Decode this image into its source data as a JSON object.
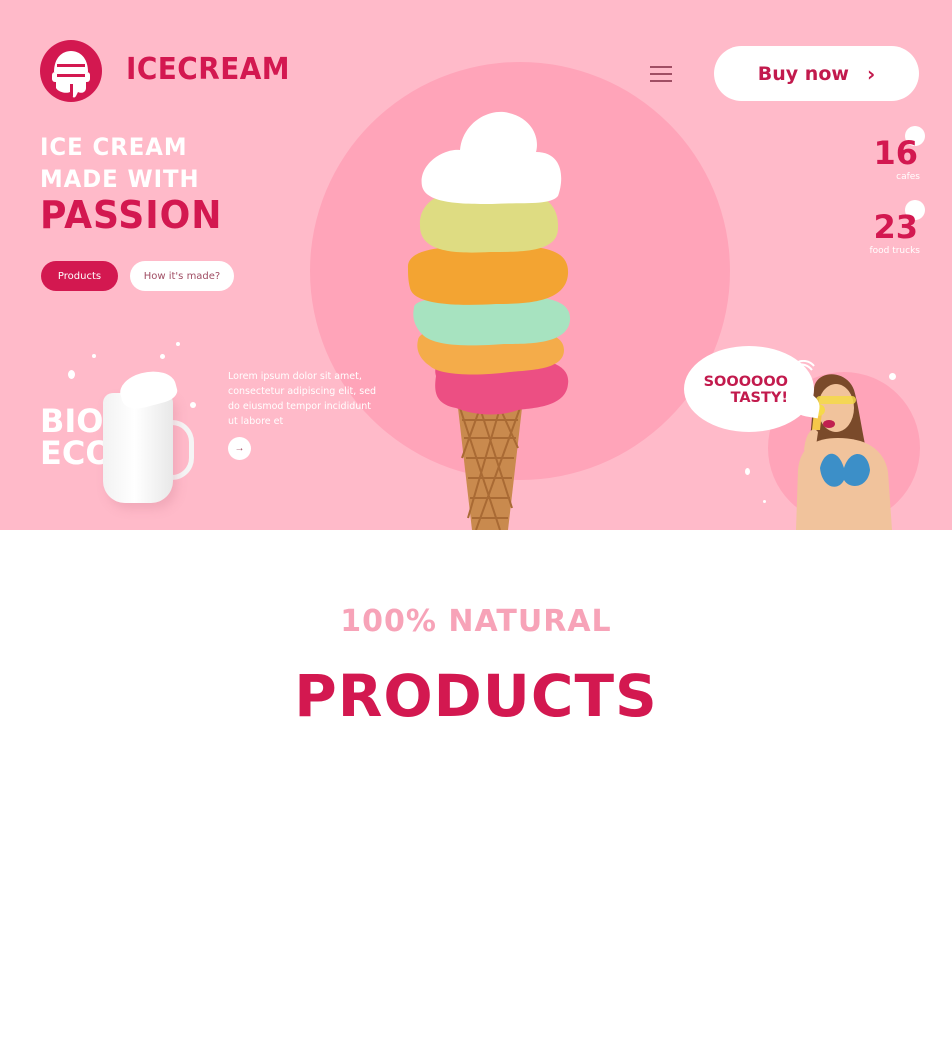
{
  "brand": {
    "name": "ICECREAM",
    "logo_icon": "ice-cream-helmet-logo"
  },
  "header": {
    "menu_icon": "hamburger-menu-icon",
    "buy_label": "Buy now",
    "buy_icon": "chevron-right-icon"
  },
  "hero": {
    "headline_line1": "ICE CREAM",
    "headline_line2": "MADE WITH",
    "headline_line3": "PASSION",
    "btn_products": "Products",
    "btn_how": "How it's made?",
    "bio_line1": "BIO",
    "bio_line2": "ECO",
    "description": "Lorem ipsum dolor sit amet, consectetur adipiscing elit, sed do eiusmod tempor incididunt ut labore et",
    "arrow_icon": "arrow-right-icon",
    "bubble_line1": "SOOOOOO",
    "bubble_line2": "TASTY!"
  },
  "stats": [
    {
      "value": "16",
      "label": "cafes"
    },
    {
      "value": "23",
      "label": "food trucks"
    }
  ],
  "products_section": {
    "eyebrow": "100% NATURAL",
    "title": "PRODUCTS"
  },
  "colors": {
    "hero_bg": "#ffbac9",
    "hero_circle": "#ffa4b9",
    "accent": "#d31850",
    "eyebrow": "#f7a3b8"
  }
}
